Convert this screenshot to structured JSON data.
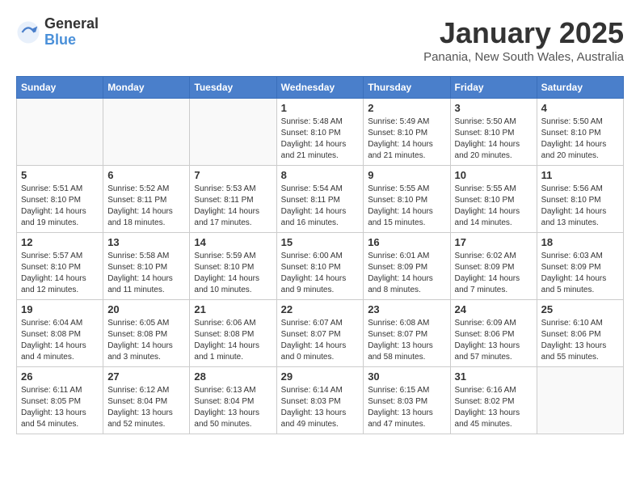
{
  "logo": {
    "general": "General",
    "blue": "Blue"
  },
  "title": "January 2025",
  "location": "Panania, New South Wales, Australia",
  "days_header": [
    "Sunday",
    "Monday",
    "Tuesday",
    "Wednesday",
    "Thursday",
    "Friday",
    "Saturday"
  ],
  "weeks": [
    [
      {
        "day": "",
        "info": ""
      },
      {
        "day": "",
        "info": ""
      },
      {
        "day": "",
        "info": ""
      },
      {
        "day": "1",
        "info": "Sunrise: 5:48 AM\nSunset: 8:10 PM\nDaylight: 14 hours\nand 21 minutes."
      },
      {
        "day": "2",
        "info": "Sunrise: 5:49 AM\nSunset: 8:10 PM\nDaylight: 14 hours\nand 21 minutes."
      },
      {
        "day": "3",
        "info": "Sunrise: 5:50 AM\nSunset: 8:10 PM\nDaylight: 14 hours\nand 20 minutes."
      },
      {
        "day": "4",
        "info": "Sunrise: 5:50 AM\nSunset: 8:10 PM\nDaylight: 14 hours\nand 20 minutes."
      }
    ],
    [
      {
        "day": "5",
        "info": "Sunrise: 5:51 AM\nSunset: 8:10 PM\nDaylight: 14 hours\nand 19 minutes."
      },
      {
        "day": "6",
        "info": "Sunrise: 5:52 AM\nSunset: 8:11 PM\nDaylight: 14 hours\nand 18 minutes."
      },
      {
        "day": "7",
        "info": "Sunrise: 5:53 AM\nSunset: 8:11 PM\nDaylight: 14 hours\nand 17 minutes."
      },
      {
        "day": "8",
        "info": "Sunrise: 5:54 AM\nSunset: 8:11 PM\nDaylight: 14 hours\nand 16 minutes."
      },
      {
        "day": "9",
        "info": "Sunrise: 5:55 AM\nSunset: 8:10 PM\nDaylight: 14 hours\nand 15 minutes."
      },
      {
        "day": "10",
        "info": "Sunrise: 5:55 AM\nSunset: 8:10 PM\nDaylight: 14 hours\nand 14 minutes."
      },
      {
        "day": "11",
        "info": "Sunrise: 5:56 AM\nSunset: 8:10 PM\nDaylight: 14 hours\nand 13 minutes."
      }
    ],
    [
      {
        "day": "12",
        "info": "Sunrise: 5:57 AM\nSunset: 8:10 PM\nDaylight: 14 hours\nand 12 minutes."
      },
      {
        "day": "13",
        "info": "Sunrise: 5:58 AM\nSunset: 8:10 PM\nDaylight: 14 hours\nand 11 minutes."
      },
      {
        "day": "14",
        "info": "Sunrise: 5:59 AM\nSunset: 8:10 PM\nDaylight: 14 hours\nand 10 minutes."
      },
      {
        "day": "15",
        "info": "Sunrise: 6:00 AM\nSunset: 8:10 PM\nDaylight: 14 hours\nand 9 minutes."
      },
      {
        "day": "16",
        "info": "Sunrise: 6:01 AM\nSunset: 8:09 PM\nDaylight: 14 hours\nand 8 minutes."
      },
      {
        "day": "17",
        "info": "Sunrise: 6:02 AM\nSunset: 8:09 PM\nDaylight: 14 hours\nand 7 minutes."
      },
      {
        "day": "18",
        "info": "Sunrise: 6:03 AM\nSunset: 8:09 PM\nDaylight: 14 hours\nand 5 minutes."
      }
    ],
    [
      {
        "day": "19",
        "info": "Sunrise: 6:04 AM\nSunset: 8:08 PM\nDaylight: 14 hours\nand 4 minutes."
      },
      {
        "day": "20",
        "info": "Sunrise: 6:05 AM\nSunset: 8:08 PM\nDaylight: 14 hours\nand 3 minutes."
      },
      {
        "day": "21",
        "info": "Sunrise: 6:06 AM\nSunset: 8:08 PM\nDaylight: 14 hours\nand 1 minute."
      },
      {
        "day": "22",
        "info": "Sunrise: 6:07 AM\nSunset: 8:07 PM\nDaylight: 14 hours\nand 0 minutes."
      },
      {
        "day": "23",
        "info": "Sunrise: 6:08 AM\nSunset: 8:07 PM\nDaylight: 13 hours\nand 58 minutes."
      },
      {
        "day": "24",
        "info": "Sunrise: 6:09 AM\nSunset: 8:06 PM\nDaylight: 13 hours\nand 57 minutes."
      },
      {
        "day": "25",
        "info": "Sunrise: 6:10 AM\nSunset: 8:06 PM\nDaylight: 13 hours\nand 55 minutes."
      }
    ],
    [
      {
        "day": "26",
        "info": "Sunrise: 6:11 AM\nSunset: 8:05 PM\nDaylight: 13 hours\nand 54 minutes."
      },
      {
        "day": "27",
        "info": "Sunrise: 6:12 AM\nSunset: 8:04 PM\nDaylight: 13 hours\nand 52 minutes."
      },
      {
        "day": "28",
        "info": "Sunrise: 6:13 AM\nSunset: 8:04 PM\nDaylight: 13 hours\nand 50 minutes."
      },
      {
        "day": "29",
        "info": "Sunrise: 6:14 AM\nSunset: 8:03 PM\nDaylight: 13 hours\nand 49 minutes."
      },
      {
        "day": "30",
        "info": "Sunrise: 6:15 AM\nSunset: 8:03 PM\nDaylight: 13 hours\nand 47 minutes."
      },
      {
        "day": "31",
        "info": "Sunrise: 6:16 AM\nSunset: 8:02 PM\nDaylight: 13 hours\nand 45 minutes."
      },
      {
        "day": "",
        "info": ""
      }
    ]
  ]
}
